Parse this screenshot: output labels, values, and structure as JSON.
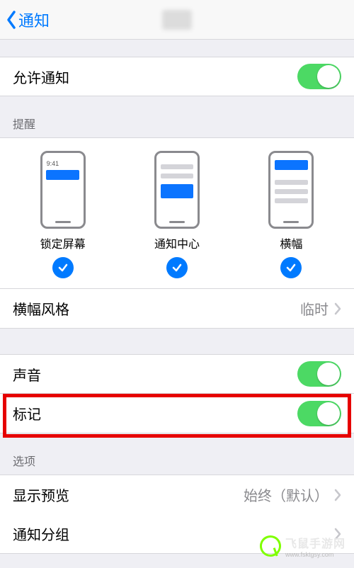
{
  "header": {
    "back_label": "通知"
  },
  "allow": {
    "label": "允许通知",
    "on": true
  },
  "alerts_header": "提醒",
  "alerts": {
    "lock": {
      "label": "锁定屏幕",
      "checked": true,
      "time": "9:41"
    },
    "center": {
      "label": "通知中心",
      "checked": true
    },
    "banner": {
      "label": "横幅",
      "checked": true
    }
  },
  "banner_style": {
    "label": "横幅风格",
    "value": "临时"
  },
  "sounds": {
    "label": "声音",
    "on": true
  },
  "badges": {
    "label": "标记",
    "on": true
  },
  "options_header": "选项",
  "preview": {
    "label": "显示预览",
    "value": "始终（默认）"
  },
  "grouping": {
    "label": "通知分组"
  },
  "watermark": {
    "name": "飞鼠手游网",
    "url": "www.fsktgsy.com"
  }
}
